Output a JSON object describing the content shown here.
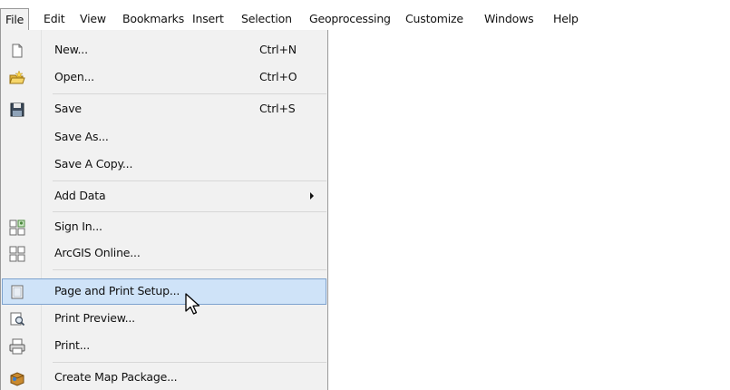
{
  "menubar": {
    "items": [
      {
        "label": "File"
      },
      {
        "label": "Edit"
      },
      {
        "label": "View"
      },
      {
        "label": "Bookmarks"
      },
      {
        "label": "Insert"
      },
      {
        "label": "Selection"
      },
      {
        "label": "Geoprocessing"
      },
      {
        "label": "Customize"
      },
      {
        "label": "Windows"
      },
      {
        "label": "Help"
      }
    ]
  },
  "file_menu": {
    "items": [
      {
        "label": "New...",
        "shortcut": "Ctrl+N",
        "icon": "new-document-icon"
      },
      {
        "label": "Open...",
        "shortcut": "Ctrl+O",
        "icon": "open-folder-icon"
      },
      {
        "label": "Save",
        "shortcut": "Ctrl+S",
        "icon": "save-disk-icon"
      },
      {
        "label": "Save As...",
        "shortcut": "",
        "icon": ""
      },
      {
        "label": "Save A Copy...",
        "shortcut": "",
        "icon": ""
      },
      {
        "label": "Add Data",
        "shortcut": "",
        "icon": "submenu-arrow"
      },
      {
        "label": "Sign In...",
        "shortcut": "",
        "icon": "sign-in-icon"
      },
      {
        "label": "ArcGIS Online...",
        "shortcut": "",
        "icon": "arcgis-online-icon"
      },
      {
        "label": "Page and Print Setup...",
        "shortcut": "",
        "icon": "page-setup-icon",
        "highlighted": true
      },
      {
        "label": "Print Preview...",
        "shortcut": "",
        "icon": "print-preview-icon"
      },
      {
        "label": "Print...",
        "shortcut": "",
        "icon": "printer-icon"
      },
      {
        "label": "Create Map Package...",
        "shortcut": "",
        "icon": "map-package-icon"
      }
    ]
  },
  "colors": {
    "highlight_bg": "#cfe3f8",
    "highlight_border": "#7da2ce",
    "menu_bg": "#f1f1f1"
  }
}
